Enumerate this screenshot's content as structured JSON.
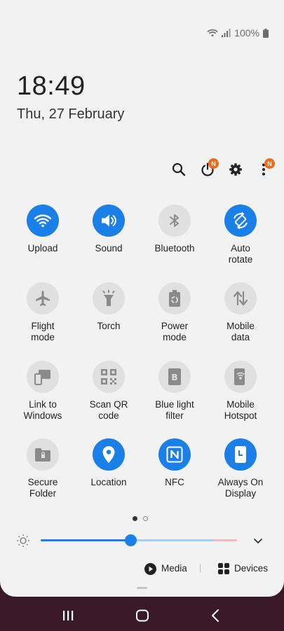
{
  "status_bar": {
    "battery_text": "100%",
    "icons": [
      "wifi-icon",
      "signal-icon",
      "battery-icon"
    ]
  },
  "clock": {
    "time": "18:49",
    "date": "Thu, 27 February"
  },
  "header_icons": {
    "search": "search-icon",
    "power": "power-icon",
    "power_badge": "N",
    "settings": "gear-icon",
    "more": "more-icon",
    "more_badge": "N"
  },
  "tiles": [
    {
      "label": "Upload",
      "icon": "wifi-icon",
      "on": true
    },
    {
      "label": "Sound",
      "icon": "speaker-icon",
      "on": true
    },
    {
      "label": "Bluetooth",
      "icon": "bluetooth-icon",
      "on": false
    },
    {
      "label": "Auto\nrotate",
      "icon": "auto-rotate-icon",
      "on": true
    },
    {
      "label": "Flight\nmode",
      "icon": "airplane-icon",
      "on": false
    },
    {
      "label": "Torch",
      "icon": "torch-icon",
      "on": false
    },
    {
      "label": "Power\nmode",
      "icon": "power-mode-icon",
      "on": false
    },
    {
      "label": "Mobile\ndata",
      "icon": "mobile-data-icon",
      "on": false
    },
    {
      "label": "Link to\nWindows",
      "icon": "link-windows-icon",
      "on": false
    },
    {
      "label": "Scan QR\ncode",
      "icon": "qr-code-icon",
      "on": false
    },
    {
      "label": "Blue light\nfilter",
      "icon": "blue-light-icon",
      "on": false
    },
    {
      "label": "Mobile\nHotspot",
      "icon": "hotspot-icon",
      "on": false
    },
    {
      "label": "Secure\nFolder",
      "icon": "secure-folder-icon",
      "on": false
    },
    {
      "label": "Location",
      "icon": "location-icon",
      "on": true
    },
    {
      "label": "NFC",
      "icon": "nfc-icon",
      "on": true
    },
    {
      "label": "Always On\nDisplay",
      "icon": "always-on-display-icon",
      "on": true
    }
  ],
  "pager": {
    "pages": 2,
    "current": 1
  },
  "brightness": {
    "level": 0.46,
    "icon": "brightness-icon",
    "expand_icon": "chevron-down-icon"
  },
  "bottom": {
    "media_label": "Media",
    "devices_label": "Devices",
    "separator": "|"
  },
  "colors": {
    "accent": "#1a7fe6",
    "off_tile": "#e0e0e0",
    "badge": "#f06a1d",
    "panel": "#f2f2f2"
  },
  "nav": [
    "recent-apps-icon",
    "home-icon",
    "back-icon"
  ]
}
